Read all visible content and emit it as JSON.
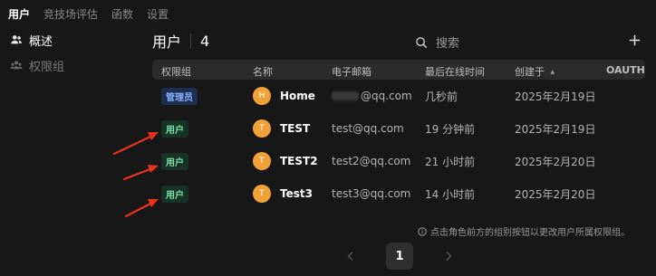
{
  "topnav": {
    "tabs": [
      {
        "label": "用户",
        "active": true
      },
      {
        "label": "竞技场评估",
        "active": false
      },
      {
        "label": "函数",
        "active": false
      },
      {
        "label": "设置",
        "active": false
      }
    ]
  },
  "sidebar": {
    "items": [
      {
        "label": "概述",
        "icon": "users-icon",
        "active": true
      },
      {
        "label": "权限组",
        "icon": "group-icon",
        "active": false
      }
    ]
  },
  "header": {
    "title": "用户",
    "count": "4",
    "search_placeholder": "搜索",
    "add_icon": "plus-icon"
  },
  "table": {
    "columns": [
      "权限组",
      "名称",
      "电子邮箱",
      "最后在线时间",
      "创建于",
      "OAUTH"
    ],
    "sort_indicator": "▲",
    "rows": [
      {
        "role": "管理员",
        "role_type": "admin",
        "avatar": "H",
        "name": "Home",
        "email_suffix": "@qq.com",
        "email_redacted": true,
        "last_online": "几秒前",
        "created": "2025年2月19日"
      },
      {
        "role": "用户",
        "role_type": "user",
        "avatar": "T",
        "name": "TEST",
        "email": "test@qq.com",
        "last_online": "19 分钟前",
        "created": "2025年2月19日"
      },
      {
        "role": "用户",
        "role_type": "user",
        "avatar": "T",
        "name": "TEST2",
        "email": "test2@qq.com",
        "last_online": "21 小时前",
        "created": "2025年2月20日"
      },
      {
        "role": "用户",
        "role_type": "user",
        "avatar": "T",
        "name": "Test3",
        "email": "test3@qq.com",
        "last_online": "14 小时前",
        "created": "2025年2月20日"
      }
    ]
  },
  "note": "点击角色前方的组别按钮以更改用户所属权限组。",
  "pagination": {
    "current": "1"
  },
  "colors": {
    "background": "#171717",
    "admin_badge_bg": "#1c2d4f",
    "admin_badge_text": "#8bb0ff",
    "user_badge_bg": "#173325",
    "user_badge_text": "#7ee2a8",
    "avatar": "#f0a239",
    "annotation_arrow": "#e8321e"
  }
}
